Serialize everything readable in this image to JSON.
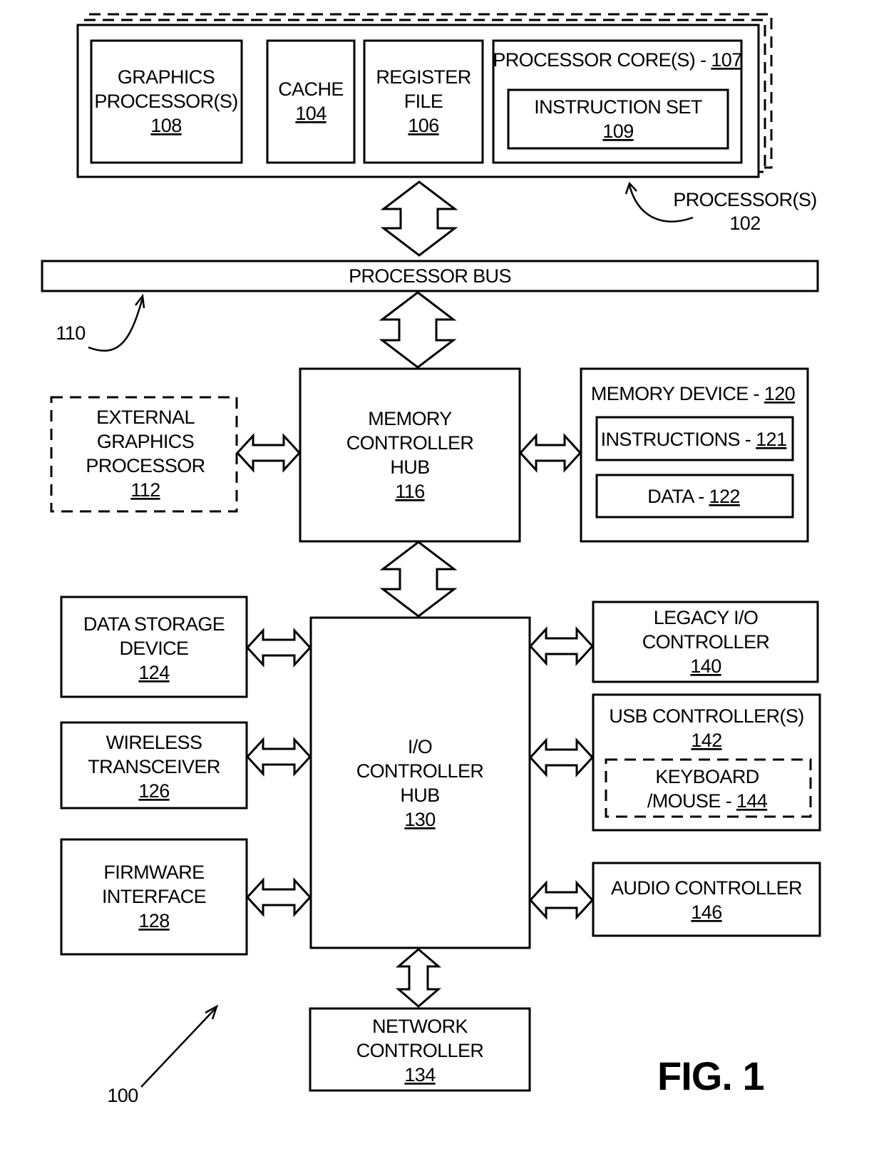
{
  "figure": {
    "title": "FIG. 1",
    "system_ref": "100"
  },
  "processor": {
    "label": "PROCESSOR(S)",
    "ref": "102",
    "components": {
      "graphics_processor": {
        "lines": [
          "GRAPHICS",
          "PROCESSOR(S)"
        ],
        "ref": "108"
      },
      "cache": {
        "lines": [
          "CACHE"
        ],
        "ref": "104"
      },
      "register_file": {
        "lines": [
          "REGISTER",
          "FILE"
        ],
        "ref": "106"
      },
      "processor_core": {
        "label": "PROCESSOR CORE(S) - ",
        "ref": "107"
      },
      "instruction_set": {
        "lines": [
          "INSTRUCTION SET"
        ],
        "ref": "109"
      }
    }
  },
  "processor_bus": {
    "label": "PROCESSOR BUS",
    "ref": "110"
  },
  "memory_controller_hub": {
    "lines": [
      "MEMORY",
      "CONTROLLER",
      "HUB"
    ],
    "ref": "116"
  },
  "external_graphics": {
    "lines": [
      "EXTERNAL",
      "GRAPHICS",
      "PROCESSOR"
    ],
    "ref": "112"
  },
  "memory_device": {
    "label": "MEMORY DEVICE - ",
    "ref": "120",
    "instructions": {
      "label": "INSTRUCTIONS - ",
      "ref": "121"
    },
    "data": {
      "label": "DATA - ",
      "ref": "122"
    }
  },
  "io_controller_hub": {
    "lines": [
      "I/O",
      "CONTROLLER",
      "HUB"
    ],
    "ref": "130"
  },
  "left_devices": [
    {
      "id": "data-storage-device",
      "lines": [
        "DATA STORAGE",
        "DEVICE"
      ],
      "ref": "124"
    },
    {
      "id": "wireless-transceiver",
      "lines": [
        "WIRELESS",
        "TRANSCEIVER"
      ],
      "ref": "126"
    },
    {
      "id": "firmware-interface",
      "lines": [
        "FIRMWARE",
        "INTERFACE"
      ],
      "ref": "128"
    }
  ],
  "right_devices": {
    "legacy_io": {
      "lines": [
        "LEGACY I/O",
        "CONTROLLER"
      ],
      "ref": "140"
    },
    "usb": {
      "lines": [
        "USB CONTROLLER(S)"
      ],
      "ref": "142"
    },
    "keyboard_mouse": {
      "lines": [
        "KEYBOARD"
      ],
      "label": "/MOUSE - ",
      "ref": "144"
    },
    "audio": {
      "lines": [
        "AUDIO CONTROLLER"
      ],
      "ref": "146"
    }
  },
  "network_controller": {
    "lines": [
      "NETWORK",
      "CONTROLLER"
    ],
    "ref": "134"
  }
}
